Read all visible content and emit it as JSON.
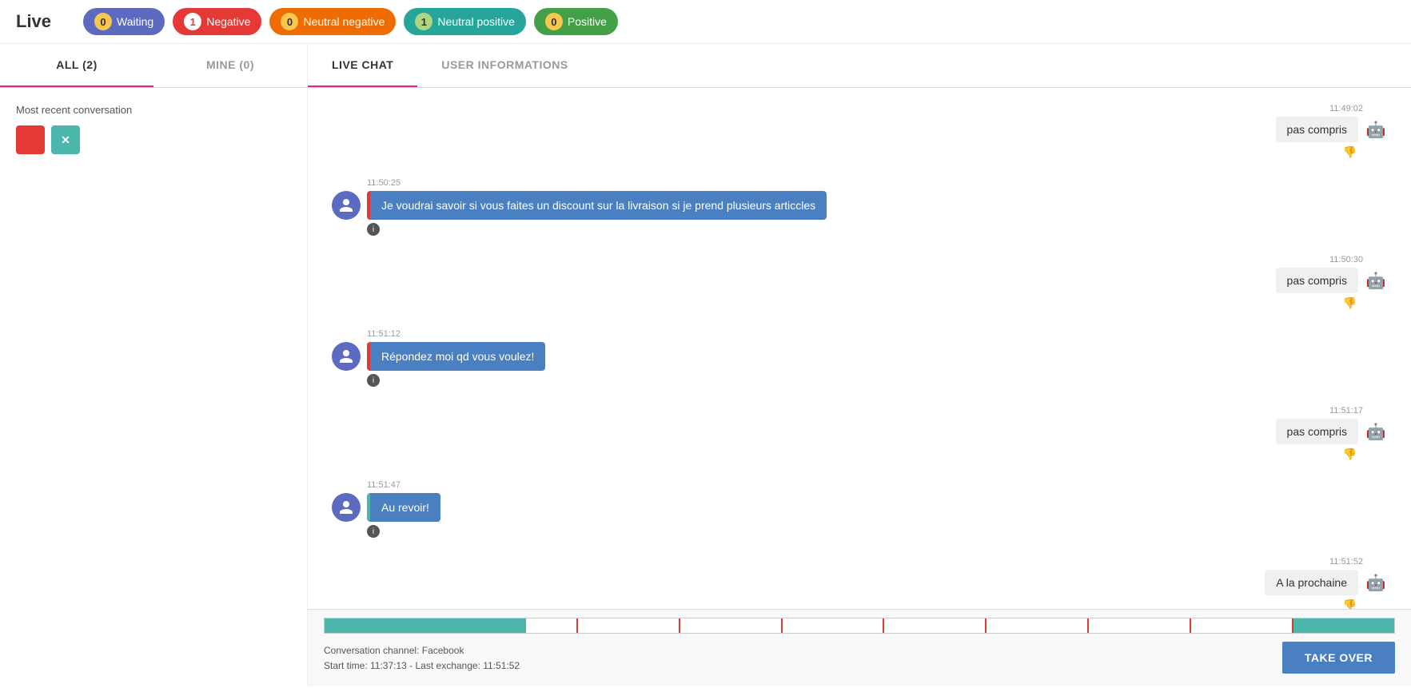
{
  "header": {
    "title": "Live",
    "badges": [
      {
        "id": "waiting",
        "count": "0",
        "label": "Waiting",
        "class": "badge-waiting",
        "count_color": "#f9c74f"
      },
      {
        "id": "negative",
        "count": "1",
        "label": "Negative",
        "class": "badge-negative",
        "count_color": "#fff"
      },
      {
        "id": "neutral-negative",
        "count": "0",
        "label": "Neutral negative",
        "class": "badge-neutral-negative",
        "count_color": "#f9c74f"
      },
      {
        "id": "neutral-positive",
        "count": "1",
        "label": "Neutral positive",
        "class": "badge-neutral-positive",
        "count_color": "#aed581"
      },
      {
        "id": "positive",
        "count": "0",
        "label": "Positive",
        "class": "badge-positive",
        "count_color": "#f9c74f"
      }
    ]
  },
  "sidebar": {
    "tab_all": "ALL (2)",
    "tab_mine": "MINE (0)",
    "section_label": "Most recent conversation",
    "btn_red_label": "",
    "btn_close_label": "✕"
  },
  "chat": {
    "tab_live": "LIVE CHAT",
    "tab_user": "USER INFORMATIONS",
    "messages": [
      {
        "type": "bot",
        "time": "11:49:02",
        "text": "pas compris"
      },
      {
        "type": "user",
        "time": "11:50:25",
        "text": "Je voudrai savoir si vous faites un discount sur la livraison si je prend plusieurs articcles",
        "border": "red"
      },
      {
        "type": "bot",
        "time": "11:50:30",
        "text": "pas compris"
      },
      {
        "type": "user",
        "time": "11:51:12",
        "text": "Répondez moi qd vous voulez!",
        "border": "red"
      },
      {
        "type": "bot",
        "time": "11:51:17",
        "text": "pas compris"
      },
      {
        "type": "user",
        "time": "11:51:47",
        "text": "Au revoir!",
        "border": "teal"
      },
      {
        "type": "bot",
        "time": "11:51:52",
        "text": "A la prochaine"
      }
    ],
    "footer": {
      "channel_label": "Conversation channel: Facebook",
      "start_time_label": "Start time: 11:37:13 - Last exchange: 11:51:52",
      "take_over_label": "TAKE OVER"
    }
  }
}
